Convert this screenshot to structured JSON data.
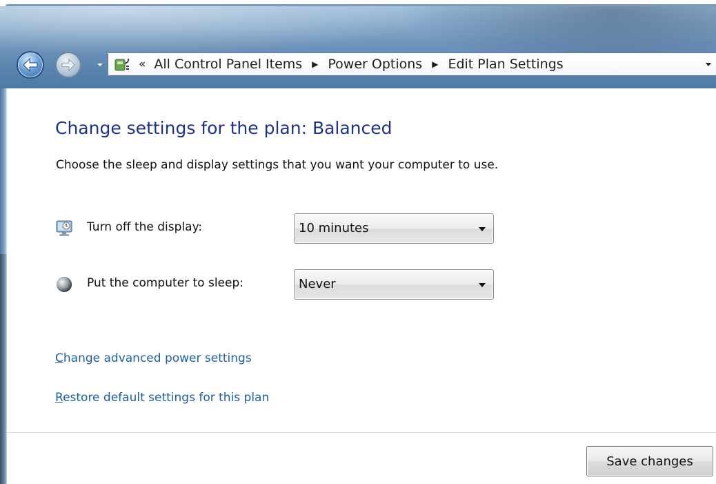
{
  "breadcrumb": {
    "overflow": "«",
    "items": [
      "All Control Panel Items",
      "Power Options",
      "Edit Plan Settings"
    ]
  },
  "page": {
    "title": "Change settings for the plan: Balanced",
    "description": "Choose the sleep and display settings that you want your computer to use."
  },
  "settings": {
    "display": {
      "label": "Turn off the display:",
      "value": "10 minutes",
      "icon": "display-icon"
    },
    "sleep": {
      "label": "Put the computer to sleep:",
      "value": "Never",
      "icon": "sleep-moon-icon"
    }
  },
  "links": {
    "advanced": {
      "accel": "C",
      "rest": "hange advanced power settings"
    },
    "restore": {
      "accel": "R",
      "rest": "estore default settings for this plan"
    }
  },
  "buttons": {
    "save": "Save changes"
  },
  "colors": {
    "title": "#1e3287",
    "link": "#1e5fa3",
    "aero": "#5b84ad"
  }
}
